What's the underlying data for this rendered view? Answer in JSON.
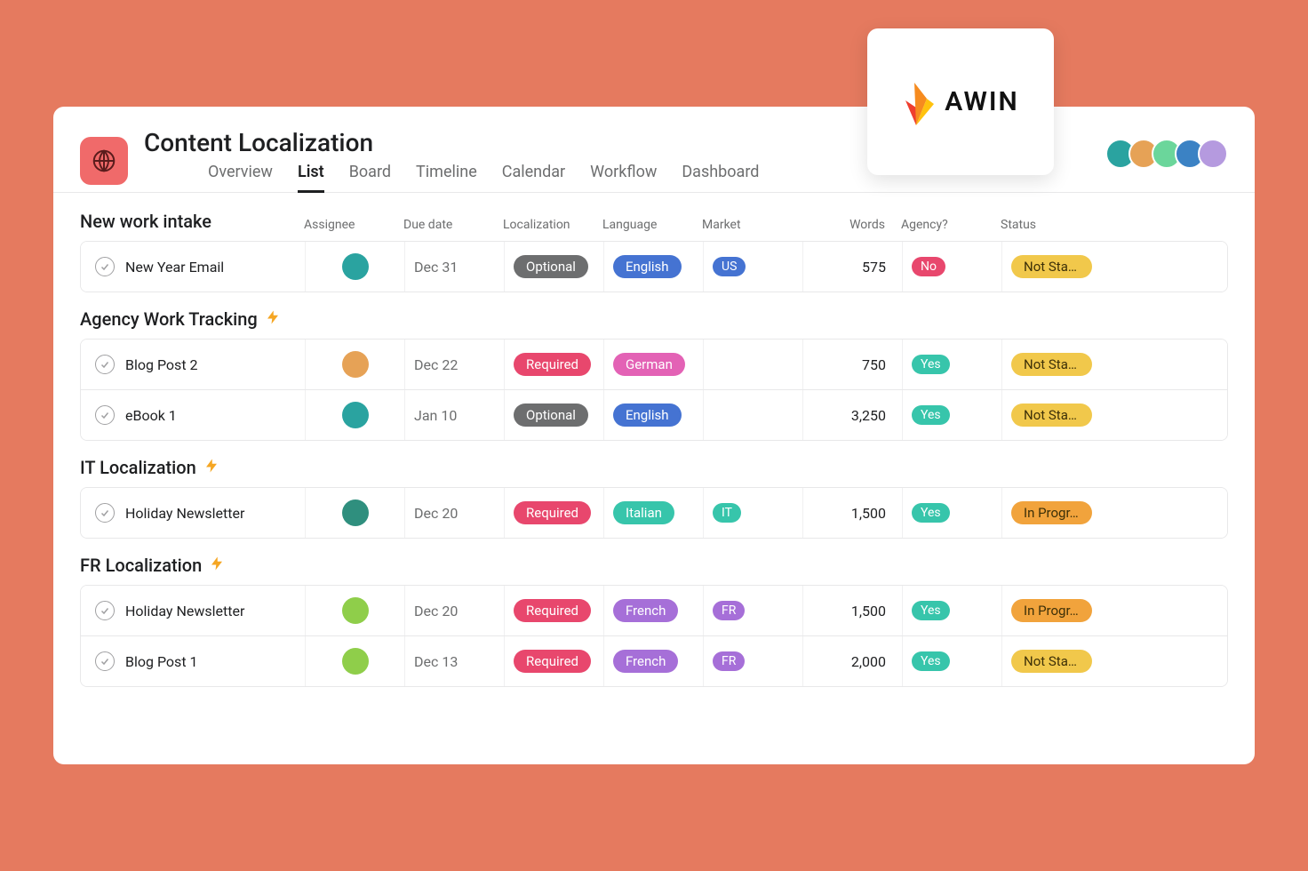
{
  "logo": {
    "text": "AWIN"
  },
  "header": {
    "title": "Content Localization",
    "tabs": [
      "Overview",
      "List",
      "Board",
      "Timeline",
      "Calendar",
      "Workflow",
      "Dashboard"
    ],
    "active_tab_index": 1,
    "team_avatars": [
      {
        "bg": "#2aa3a0"
      },
      {
        "bg": "#e6a256"
      },
      {
        "bg": "#6bd69b"
      },
      {
        "bg": "#3b82c4"
      },
      {
        "bg": "#b59adf"
      }
    ]
  },
  "columns": [
    "Assignee",
    "Due date",
    "Localization",
    "Language",
    "Market",
    "Words",
    "Agency?",
    "Status"
  ],
  "pill_colors": {
    "Optional": "#6d6e6f",
    "Required": "#e8476d",
    "English": "#4573d2",
    "German": "#e362b5",
    "Italian": "#37c5ab",
    "French": "#a66fd8",
    "US": "#4573d2",
    "IT": "#37c5ab",
    "FR": "#a66fd8",
    "Yes": "#37c5ab",
    "No": "#e8476d",
    "Not Star...": "#f1c84b",
    "In Progr...": "#f1a33c"
  },
  "dark_text_pills": [
    "Not Star...",
    "In Progr..."
  ],
  "sections": [
    {
      "title": "New work intake",
      "bolt": false,
      "rows": [
        {
          "task": "New Year Email",
          "assignee_bg": "#2aa3a0",
          "due": "Dec 31",
          "localization": "Optional",
          "language": "English",
          "market": "US",
          "words": "575",
          "agency": "No",
          "status": "Not Star..."
        }
      ]
    },
    {
      "title": "Agency Work Tracking",
      "bolt": true,
      "rows": [
        {
          "task": "Blog Post 2",
          "assignee_bg": "#e6a256",
          "due": "Dec 22",
          "localization": "Required",
          "language": "German",
          "market": "",
          "words": "750",
          "agency": "Yes",
          "status": "Not Star..."
        },
        {
          "task": "eBook 1",
          "assignee_bg": "#2aa3a0",
          "due": "Jan 10",
          "localization": "Optional",
          "language": "English",
          "market": "",
          "words": "3,250",
          "agency": "Yes",
          "status": "Not Star..."
        }
      ]
    },
    {
      "title": "IT Localization",
      "bolt": true,
      "rows": [
        {
          "task": "Holiday Newsletter",
          "assignee_bg": "#2f8f7e",
          "due": "Dec 20",
          "localization": "Required",
          "language": "Italian",
          "market": "IT",
          "words": "1,500",
          "agency": "Yes",
          "status": "In Progr..."
        }
      ]
    },
    {
      "title": "FR Localization",
      "bolt": true,
      "rows": [
        {
          "task": "Holiday Newsletter",
          "assignee_bg": "#8fce4a",
          "due": "Dec 20",
          "localization": "Required",
          "language": "French",
          "market": "FR",
          "words": "1,500",
          "agency": "Yes",
          "status": "In Progr..."
        },
        {
          "task": "Blog Post 1",
          "assignee_bg": "#8fce4a",
          "due": "Dec 13",
          "localization": "Required",
          "language": "French",
          "market": "FR",
          "words": "2,000",
          "agency": "Yes",
          "status": "Not Star..."
        }
      ]
    }
  ]
}
